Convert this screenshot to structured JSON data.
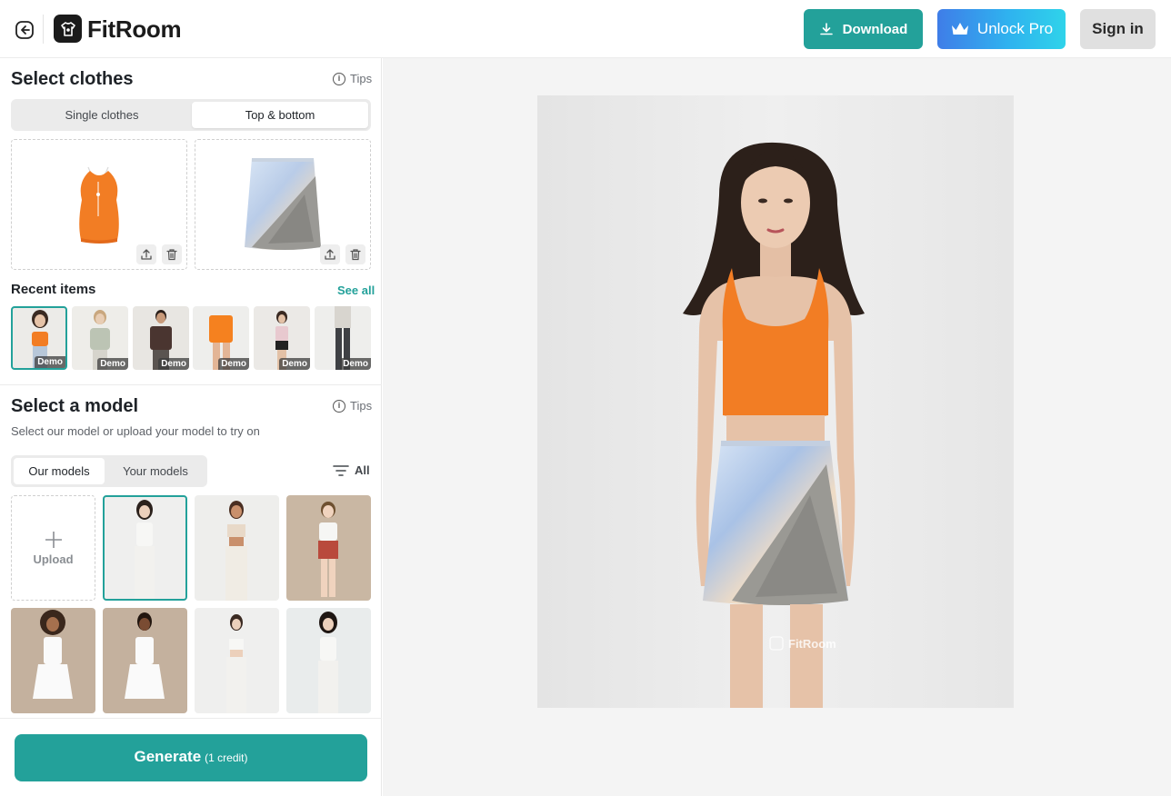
{
  "header": {
    "logo_text": "FitRoom",
    "download_label": "Download",
    "unlock_label": "Unlock Pro",
    "signin_label": "Sign in"
  },
  "clothes": {
    "title": "Select clothes",
    "tips_label": "Tips",
    "tabs": [
      {
        "label": "Single clothes",
        "active": false
      },
      {
        "label": "Top & bottom",
        "active": true
      }
    ]
  },
  "recent": {
    "title": "Recent items",
    "see_all": "See all",
    "items": [
      {
        "badge": "Demo",
        "selected": true
      },
      {
        "badge": "Demo",
        "selected": false
      },
      {
        "badge": "Demo",
        "selected": false
      },
      {
        "badge": "Demo",
        "selected": false
      },
      {
        "badge": "Demo",
        "selected": false
      },
      {
        "badge": "Demo",
        "selected": false
      }
    ]
  },
  "model": {
    "title": "Select a model",
    "tips_label": "Tips",
    "subtitle": "Select our model or upload your model to try on",
    "tabs": [
      {
        "label": "Our models",
        "active": true
      },
      {
        "label": "Your models",
        "active": false
      }
    ],
    "filter_label": "All",
    "upload_label": "Upload"
  },
  "generate": {
    "label": "Generate",
    "credit": "(1 credit)"
  },
  "watermark": "FitRoom",
  "colors": {
    "accent": "#23a19a",
    "pro_gradient_start": "#3f7de8",
    "pro_gradient_end": "#2fd3ea"
  }
}
